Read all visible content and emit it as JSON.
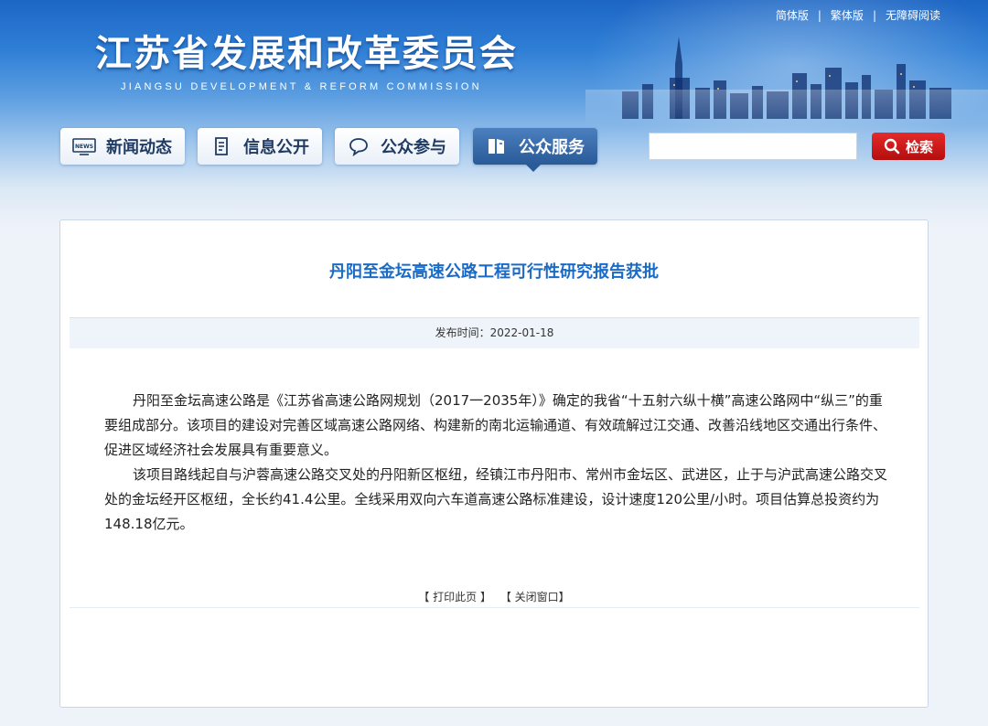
{
  "top_links": [
    "简体版",
    "繁体版",
    "无障碍阅读"
  ],
  "site": {
    "name_cn": "江苏省发展和改革委员会",
    "name_en": "JIANGSU DEVELOPMENT & REFORM COMMISSION"
  },
  "nav": [
    {
      "label": "新闻动态",
      "icon": "news-icon"
    },
    {
      "label": "信息公开",
      "icon": "document-icon"
    },
    {
      "label": "公众参与",
      "icon": "chat-bubble-icon"
    },
    {
      "label": "公众服务",
      "icon": "service-book-icon",
      "active": true
    }
  ],
  "search": {
    "placeholder": "",
    "button_label": "检索"
  },
  "article": {
    "title": "丹阳至金坛高速公路工程可行性研究报告获批",
    "publish_label": "发布时间：2022-01-18",
    "paragraphs": [
      "丹阳至金坛高速公路是《江苏省高速公路网规划（2017一2035年）》确定的我省“十五射六纵十横”高速公路网中“纵三”的重要组成部分。该项目的建设对完善区域高速公路网络、构建新的南北运输通道、有效疏解过江交通、改善沿线地区交通出行条件、促进区域经济社会发展具有重要意义。",
      "该项目路线起自与沪蓉高速公路交叉处的丹阳新区枢纽，经镇江市丹阳市、常州市金坛区、武进区，止于与沪武高速公路交叉处的金坛经开区枢纽，全长约41.4公里。全线采用双向六车道高速公路标准建设，设计速度120公里/小时。项目估算总投资约为148.18亿元。"
    ],
    "print_label": "【 打印此页 】",
    "close_label": "【 关闭窗口】"
  },
  "colors": {
    "title": "#1a6bc8",
    "search_button": "#c9151e",
    "nav_active": "#2a5a98"
  }
}
